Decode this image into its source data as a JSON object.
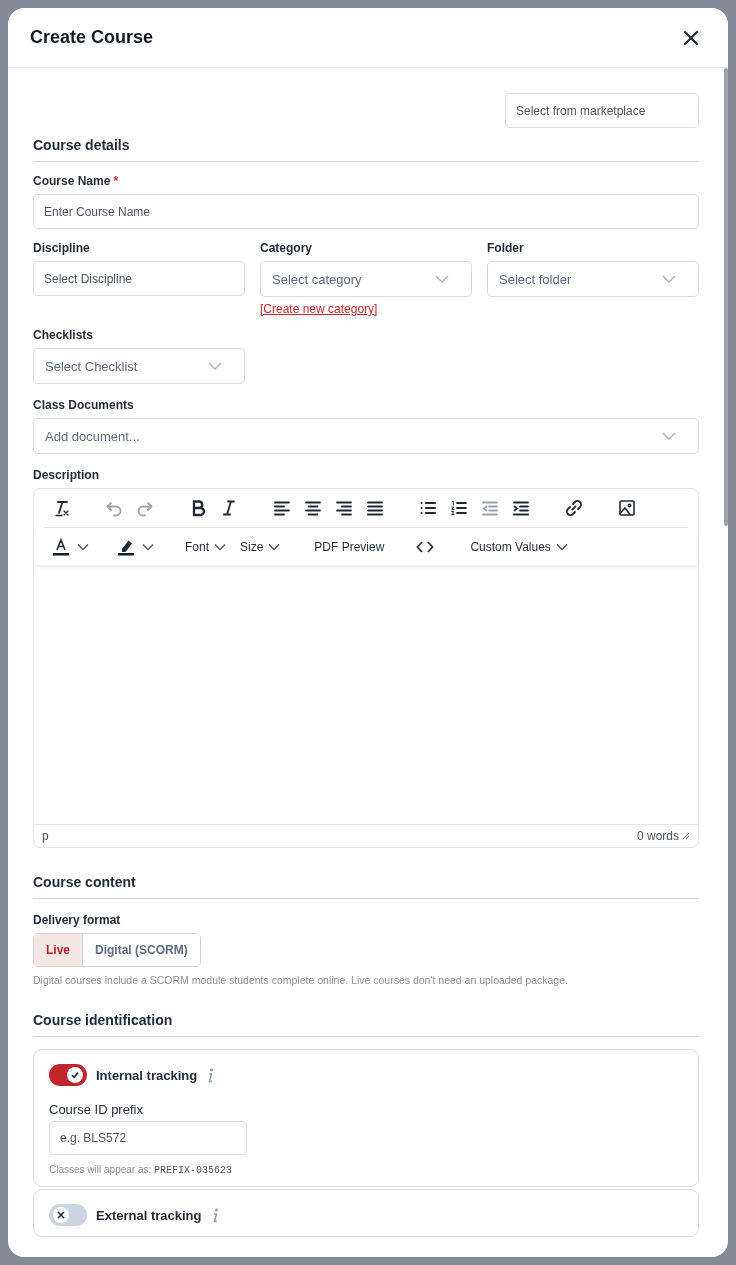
{
  "window": {
    "title": "Create Course"
  },
  "marketplace_button": "Select from marketplace",
  "course_details": {
    "heading": "Course details",
    "course_name": {
      "label": "Course Name",
      "required_mark": "*",
      "placeholder": "Enter Course Name"
    },
    "discipline": {
      "label": "Discipline",
      "placeholder": "Select Discipline"
    },
    "category": {
      "label": "Category",
      "placeholder": "Select category",
      "link": "[Create new category]"
    },
    "folder": {
      "label": "Folder",
      "placeholder": "Select folder"
    },
    "checklists": {
      "label": "Checklists",
      "placeholder": "Select Checklist"
    },
    "class_documents": {
      "label": "Class Documents",
      "placeholder": "Add document..."
    },
    "description": {
      "label": "Description",
      "toolbar_groups": [
        [
          {
            "kind": "clear-format",
            "disabled": false
          }
        ],
        [
          {
            "kind": "undo",
            "disabled": true
          },
          {
            "kind": "redo",
            "disabled": true
          }
        ],
        [
          {
            "kind": "bold",
            "disabled": false
          },
          {
            "kind": "italic",
            "disabled": false
          }
        ],
        [
          {
            "kind": "align-left",
            "disabled": false
          },
          {
            "kind": "align-center",
            "disabled": false
          },
          {
            "kind": "align-right",
            "disabled": false
          },
          {
            "kind": "justify",
            "disabled": false
          }
        ],
        [
          {
            "kind": "bullet-list",
            "disabled": false
          },
          {
            "kind": "numbered-list",
            "disabled": false
          },
          {
            "kind": "outdent",
            "disabled": true
          },
          {
            "kind": "indent",
            "disabled": false
          }
        ],
        [
          {
            "kind": "link",
            "disabled": false
          }
        ],
        [
          {
            "kind": "image",
            "disabled": false
          }
        ]
      ],
      "font": "Font",
      "size": "Size",
      "pdf_preview": "PDF Preview",
      "custom_values": "Custom Values",
      "path": "p",
      "word_count": "0 words"
    }
  },
  "course_content": {
    "heading": "Course content",
    "delivery_format": {
      "label": "Delivery format",
      "options": [
        {
          "label": "Live",
          "selected": true
        },
        {
          "label": "Digital (SCORM)",
          "selected": false
        }
      ],
      "hint": "Digital courses include a SCORM module students complete online. Live courses don't need an uploaded package."
    }
  },
  "course_identification": {
    "heading": "Course identification",
    "trackings": [
      {
        "label": "Internal tracking",
        "on": true,
        "prefix_label": "Course ID prefix",
        "placeholder": "e.g. BLS572",
        "hint": "Classes will appear as:",
        "hint_code": "PREFIX-035623"
      },
      {
        "label": "External tracking",
        "on": false
      }
    ]
  }
}
